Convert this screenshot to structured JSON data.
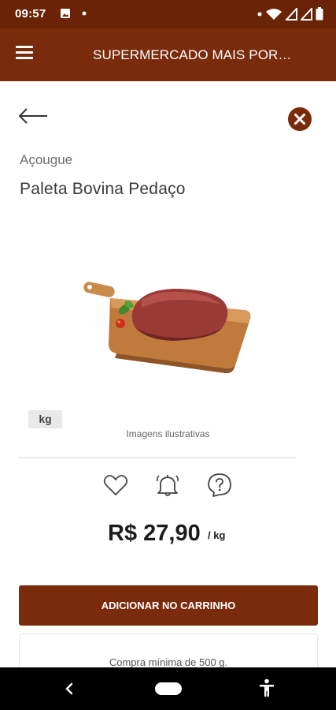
{
  "status_bar": {
    "time": "09:57",
    "icons": [
      "image-icon",
      "dot-icon",
      "dot-icon",
      "wifi-icon",
      "signal-icon",
      "signal-icon",
      "battery-icon"
    ]
  },
  "app_bar": {
    "title": "SUPERMERCADO MAIS POR…",
    "menu_icon": "hamburger-menu-icon",
    "color": "#7a2b0c"
  },
  "product": {
    "category": "Açougue",
    "name": "Paleta Bovina Pedaço",
    "unit_badge": "kg",
    "image_note": "Imagens ilustrativas",
    "price": "R$ 27,90",
    "price_unit": "/ kg"
  },
  "actions": {
    "favorite_icon": "heart-icon",
    "alert_icon": "bell-icon",
    "help_icon": "question-bubble-icon",
    "back_icon": "arrow-left-icon",
    "close_icon": "close-circle-icon"
  },
  "cart": {
    "add_label": "ADICIONAR NO CARRINHO"
  },
  "info": {
    "min_purchase": "Compra mínima de 500 g."
  },
  "colors": {
    "brand": "#7a2b0c",
    "status_bar": "#6b2307"
  }
}
